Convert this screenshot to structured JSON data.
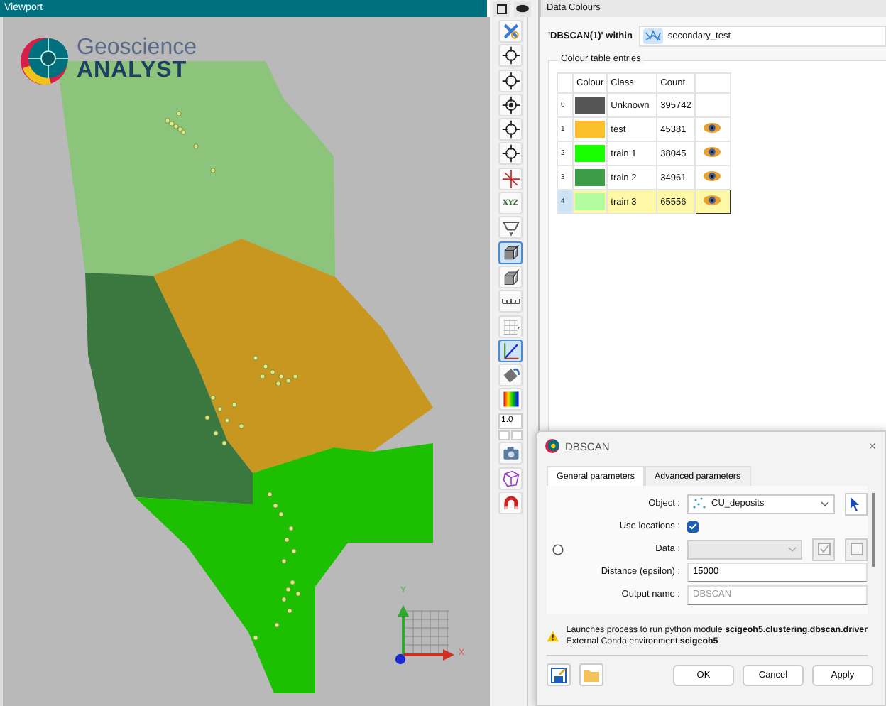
{
  "viewport": {
    "title": "Viewport",
    "logo": {
      "line_1": "Geoscience",
      "line_2": "ANALYST"
    },
    "axes": {
      "y_label": "Y",
      "x_label": "X"
    }
  },
  "toolbar": {
    "items": [
      {
        "kind": "button",
        "selected": false
      },
      {
        "kind": "button",
        "selected": false
      },
      {
        "kind": "button",
        "selected": false
      },
      {
        "kind": "button",
        "selected": false
      },
      {
        "kind": "button",
        "selected": false
      },
      {
        "kind": "button",
        "selected": false
      },
      {
        "kind": "button",
        "selected": false
      },
      {
        "kind": "text",
        "label": "XYZ",
        "selected": false
      },
      {
        "kind": "button",
        "selected": false
      },
      {
        "kind": "button",
        "selected": true
      },
      {
        "kind": "button",
        "selected": false
      },
      {
        "kind": "button",
        "selected": false
      },
      {
        "kind": "button",
        "selected": false
      },
      {
        "kind": "button",
        "selected": true
      },
      {
        "kind": "button",
        "selected": false
      },
      {
        "kind": "button",
        "selected": false
      },
      {
        "kind": "field",
        "value": "1.0"
      },
      {
        "kind": "stepper"
      },
      {
        "kind": "button",
        "selected": false
      },
      {
        "kind": "button",
        "selected": false
      },
      {
        "kind": "button",
        "selected": false
      }
    ]
  },
  "data_colours": {
    "title": "Data Colours",
    "source_label": "'DBSCAN(1)' within",
    "source": "secondary_test",
    "group_title": "Colour table entries",
    "table": {
      "columns": [
        "Colour",
        "Class",
        "Count"
      ],
      "rows": [
        {
          "index": "0",
          "color": "#555555",
          "class": "Unknown",
          "count": "395742",
          "visible": false,
          "selected": false
        },
        {
          "index": "1",
          "color": "#fbbf2c",
          "class": "test",
          "count": "45381",
          "visible": true,
          "selected": false
        },
        {
          "index": "2",
          "color": "#19ff00",
          "class": "train 1",
          "count": "38045",
          "visible": true,
          "selected": false
        },
        {
          "index": "3",
          "color": "#3e9b48",
          "class": "train 2",
          "count": "34961",
          "visible": true,
          "selected": false
        },
        {
          "index": "4",
          "color": "#b2fda0",
          "class": "train 3",
          "count": "65556",
          "visible": true,
          "selected": true
        }
      ]
    }
  },
  "dialog": {
    "title": "DBSCAN",
    "close_glyph": "×",
    "tabs": [
      {
        "label": "General parameters",
        "selected": true
      },
      {
        "label": "Advanced parameters",
        "selected": false
      }
    ],
    "fields": [
      {
        "kind": "combo",
        "label": "Object :",
        "value": "CU_deposits"
      },
      {
        "kind": "checkbox",
        "label": "Use locations :",
        "checked": true
      },
      {
        "kind": "data",
        "label": "Data :",
        "disabled": true,
        "radio_selected": false
      },
      {
        "kind": "text",
        "label": "Distance (epsilon) :",
        "value": "15000"
      },
      {
        "kind": "text",
        "label": "Output name :",
        "placeholder": "DBSCAN"
      }
    ],
    "warning": [
      "Launches process to run python module **scigeoh5.clustering.dbscan.driver**",
      "External Conda environment **scigeoh5**"
    ],
    "buttons": [
      "OK",
      "Cancel",
      "Apply"
    ]
  }
}
